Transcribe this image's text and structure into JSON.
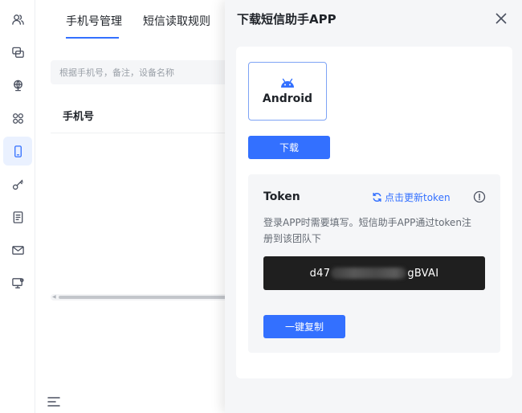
{
  "rail": {
    "items": [
      {
        "icon": "users-icon",
        "active": false
      },
      {
        "icon": "chat-icon",
        "active": false
      },
      {
        "icon": "globe-icon",
        "active": false
      },
      {
        "icon": "apps-icon",
        "active": false
      },
      {
        "icon": "mobile-icon",
        "active": true
      },
      {
        "icon": "key-icon",
        "active": false
      },
      {
        "icon": "document-icon",
        "active": false
      },
      {
        "icon": "mail-icon",
        "active": false
      },
      {
        "icon": "screen-settings-icon",
        "active": false
      }
    ],
    "bottom_icon": "menu-icon"
  },
  "page": {
    "tabs": [
      {
        "label": "手机号管理",
        "active": true
      },
      {
        "label": "短信读取规则",
        "active": false
      }
    ],
    "search_placeholder": "根据手机号，备注，设备名称",
    "table_header": "手机号"
  },
  "drawer": {
    "title": "下载短信助手APP",
    "platform": {
      "label": "Android",
      "icon": "android-icon",
      "selected": true
    },
    "download_label": "下载",
    "token": {
      "label": "Token",
      "refresh_label": "点击更新token",
      "description": "登录APP时需要填写。短信助手APP通过token注册到该团队下",
      "value_prefix": "d47",
      "value_suffix": "gBVAI"
    },
    "copy_label": "一键复制"
  },
  "colors": {
    "accent": "#3370ff",
    "token_bg": "#1f1f1f",
    "panel_bg": "#f5f6f8"
  }
}
